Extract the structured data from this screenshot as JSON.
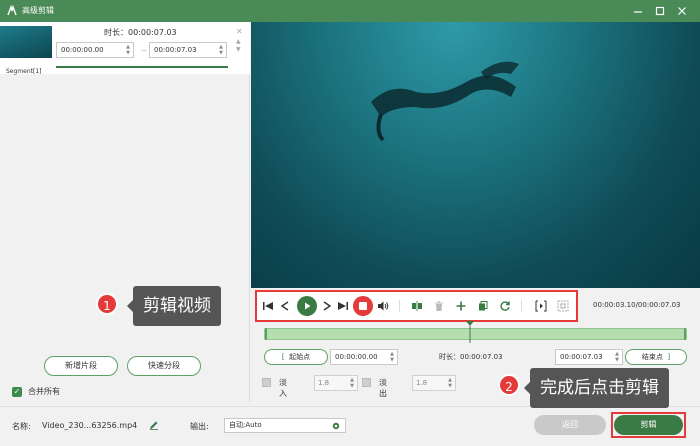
{
  "titlebar": {
    "title": "高级剪辑"
  },
  "segment": {
    "label": "Segment[1]",
    "duration_label": "时长：00:00:07.03",
    "start": "00:00:00.00",
    "separator": "--",
    "end": "00:00:07.03"
  },
  "left_actions": {
    "add_segment": "新增片段",
    "quick_split": "快速分段",
    "merge_all": "合并所有"
  },
  "player": {
    "time_readout": "00:00:03.10/00:00:07.03"
  },
  "range": {
    "start_btn": "起始点",
    "start_value": "00:00:00.00",
    "duration": "时长：00:00:07.03",
    "end_value": "00:00:07.03",
    "end_btn": "结束点"
  },
  "fade": {
    "fade_in_label": "淡入",
    "fade_in_value": "1.8",
    "fade_out_label": "淡出",
    "fade_out_value": "1.8"
  },
  "footer": {
    "name_label": "名称:",
    "name_value": "Video_230...63256.mp4",
    "output_label": "输出:",
    "output_value": "自动;Auto",
    "back": "返回",
    "cut": "剪辑"
  },
  "callouts": {
    "one_num": "1",
    "one_text": "剪辑视频",
    "two_num": "2",
    "two_text": "完成后点击剪辑"
  },
  "colors": {
    "accent": "#3a7a45",
    "highlight": "#e53a3a",
    "titlebar": "#4a8a56"
  }
}
